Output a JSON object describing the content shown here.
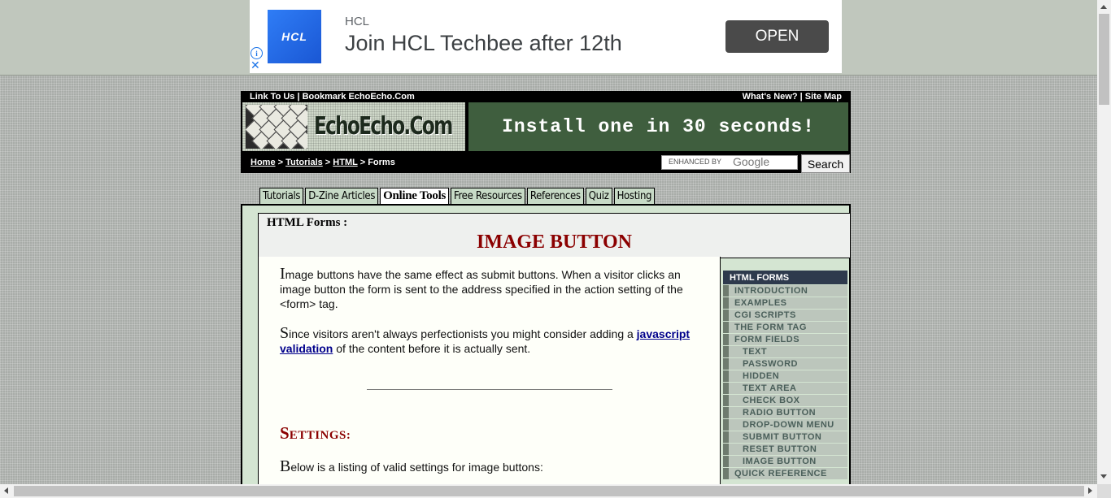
{
  "ad": {
    "brand": "HCL",
    "logo_text": "HCL",
    "headline": "Join HCL Techbee after 12th",
    "open_label": "OPEN",
    "info_icon": "i",
    "close_icon": "✕"
  },
  "header": {
    "top_left": "Link To Us | Bookmark EchoEcho.Com",
    "top_right": "What's New? | Site Map",
    "logo_text": "EchoEcho.Com",
    "banner_text": "Install one in 30 seconds!",
    "breadcrumb": {
      "home": "Home",
      "sep1": " > ",
      "tutorials": "Tutorials",
      "sep2": " > ",
      "html": "HTML",
      "sep3": " > ",
      "current": "Forms"
    },
    "search_placeholder_prefix": "ENHANCED BY",
    "search_placeholder_brand": "Google",
    "search_button": "Search"
  },
  "tabs": [
    {
      "label": "Tutorials"
    },
    {
      "label": "D-Zine Articles"
    },
    {
      "label": "Online Tools"
    },
    {
      "label": "Free Resources"
    },
    {
      "label": "References"
    },
    {
      "label": "Quiz"
    },
    {
      "label": "Hosting"
    }
  ],
  "page": {
    "section_label": "HTML Forms :",
    "title": "IMAGE BUTTON",
    "para1_cap": "I",
    "para1_rest": "mage buttons have the same effect as submit buttons. When a visitor clicks an image button the form is sent to the address specified in the action setting of the <form> tag.",
    "para2_cap": "S",
    "para2_pre": "ince visitors aren't always perfectionists you might consider adding a ",
    "para2_link": "javascript validation",
    "para2_post": " of the content before it is actually sent.",
    "settings_cap": "S",
    "settings_rest": "ETTINGS:",
    "para3_cap": "B",
    "para3_rest": "elow is a listing of valid settings for image buttons:"
  },
  "menu": {
    "head": "HTML FORMS",
    "items": [
      {
        "label": "INTRODUCTION",
        "sub": false
      },
      {
        "label": "EXAMPLES",
        "sub": false
      },
      {
        "label": "CGI SCRIPTS",
        "sub": false
      },
      {
        "label": "THE FORM TAG",
        "sub": false
      },
      {
        "label": "FORM FIELDS",
        "sub": false
      },
      {
        "label": "TEXT",
        "sub": true
      },
      {
        "label": "PASSWORD",
        "sub": true
      },
      {
        "label": "HIDDEN",
        "sub": true
      },
      {
        "label": "TEXT AREA",
        "sub": true
      },
      {
        "label": "CHECK BOX",
        "sub": true
      },
      {
        "label": "RADIO BUTTON",
        "sub": true
      },
      {
        "label": "DROP-DOWN MENU",
        "sub": true
      },
      {
        "label": "SUBMIT BUTTON",
        "sub": true
      },
      {
        "label": "RESET BUTTON",
        "sub": true
      },
      {
        "label": "IMAGE BUTTON",
        "sub": true
      },
      {
        "label": "QUICK REFERENCE",
        "sub": false
      }
    ]
  }
}
